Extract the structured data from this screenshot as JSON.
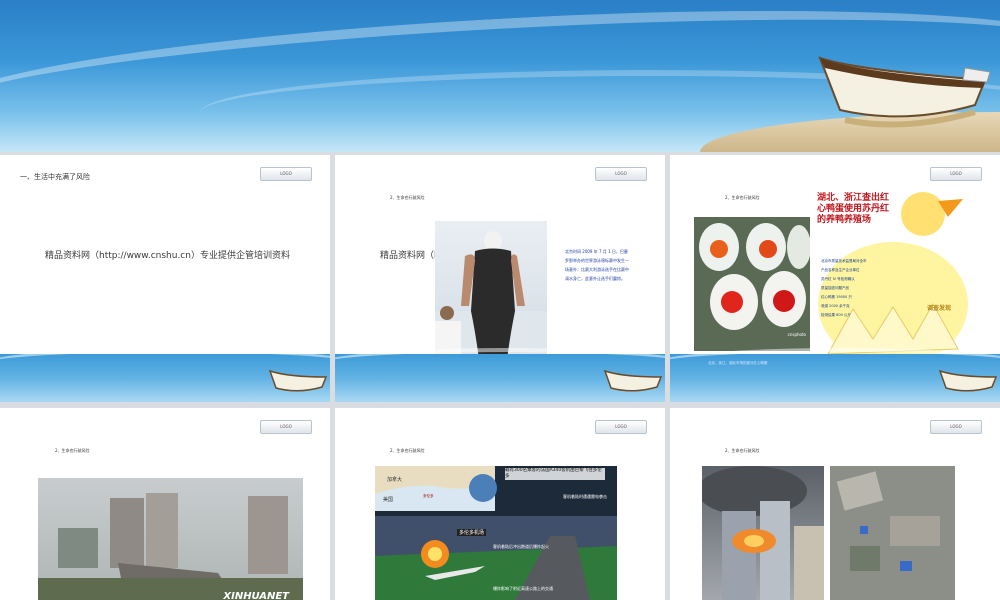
{
  "banner": {
    "name": "top-banner"
  },
  "slides": [
    {
      "logo": "LOGO",
      "title": "一、生活中充满了风险",
      "ad": "精品资料网（http://www.cnshu.cn）专业提供企管培训资料"
    },
    {
      "logo": "LOGO",
      "subtitle": "2、生命也行驶风险",
      "ad": "精品资料网（http://",
      "story": "北京时间 2009 年 7 月 1 日，巴塞罗那举办的世界游泳锦标赛中发生一场意外：比赛大利游泳选手在比赛中溺水身亡，此意外让选手们震惊。"
    },
    {
      "logo": "LOGO",
      "subtitle": "2、生命也行驶风险",
      "watermark": "cnsphoto",
      "caption": "北京，浙江、湖北市场的部分红心鸭蛋",
      "poster_title": "湖北、浙江查出红心鸭蛋使用苏丹红的养鸭养殖场",
      "poster_lines": [
        "北京市质量技术监督局对全市",
        "产品名称及生产企业单位",
        "苏丹红 IV 号检测确认",
        "质量抽查问题产品",
        "红心鸭蛋 19000 只",
        "收缴 2000 余千克",
        "检测结果 800 公斤"
      ],
      "poster_badge": "调查发现"
    },
    {
      "logo": "LOGO",
      "subtitle": "2、生命也行驶风险",
      "watermark": "XINHUANET"
    },
    {
      "logo": "LOGO",
      "subtitle": "2、生命也行驶风险",
      "map_labels": [
        "加拿大",
        "美国",
        "多伦多"
      ],
      "steps": [
        "载有300名乘客的法国A340客机由巴黎飞往多伦多",
        "客机着陆时遭遇雷电袭击",
        "客机着陆后冲出跑道后爆炸起火",
        "爆炸影响了附近高速公路上的交通"
      ],
      "airport_label": "多伦多机场"
    },
    {
      "logo": "LOGO",
      "subtitle": "2、生命也行驶风险"
    }
  ]
}
